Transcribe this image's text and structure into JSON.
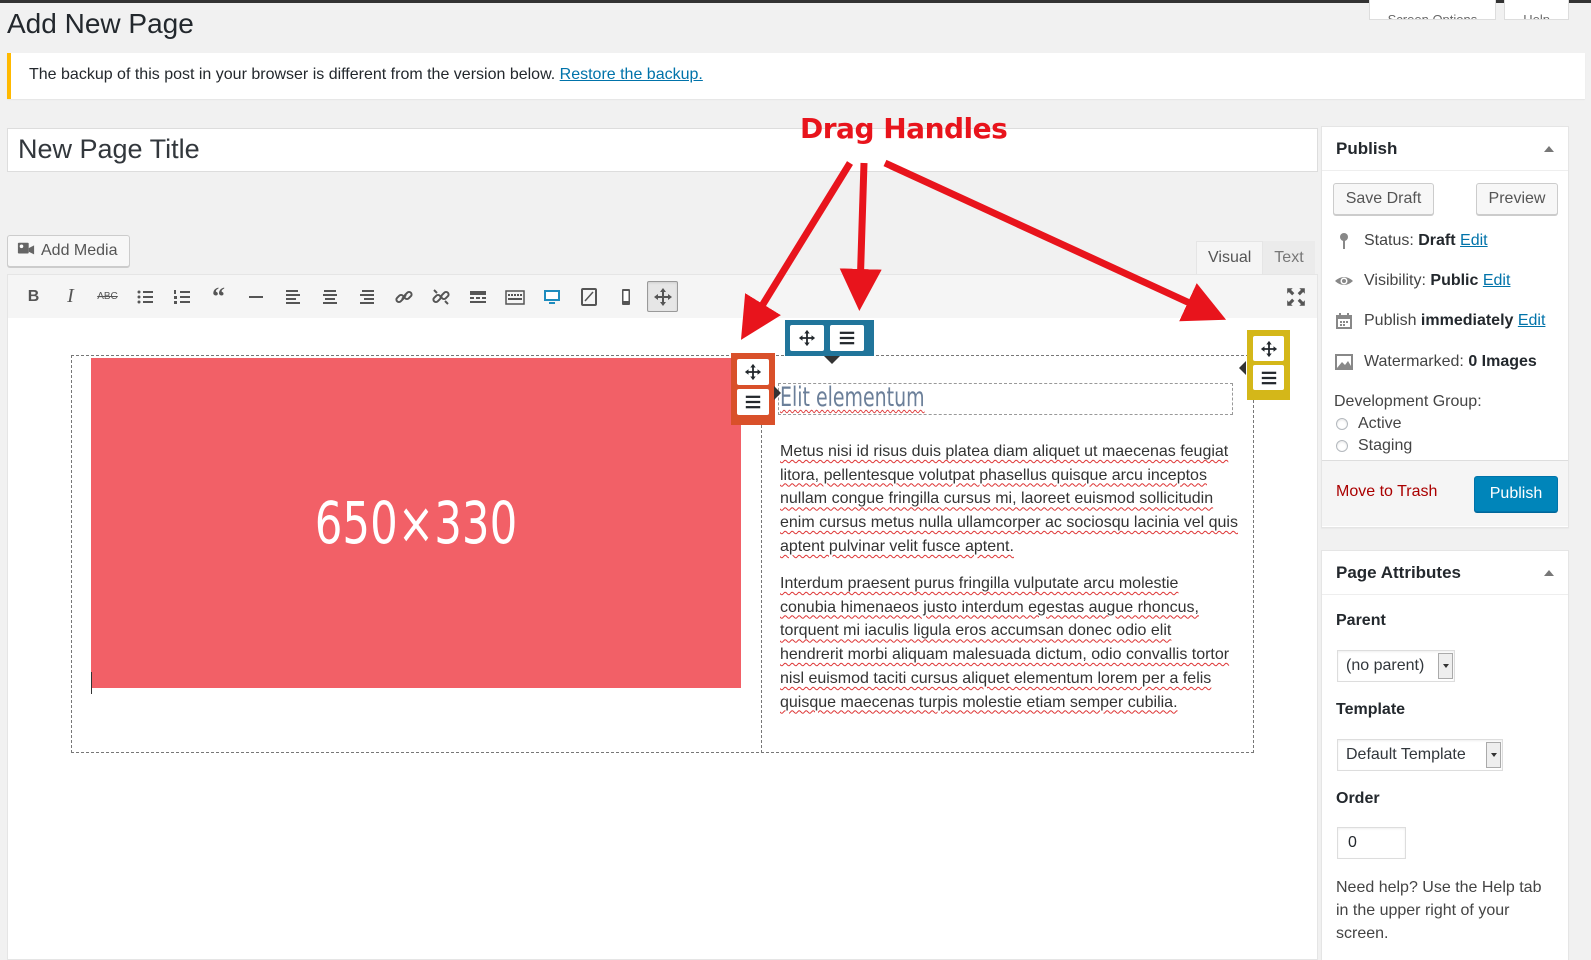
{
  "page": {
    "heading": "Add New Page"
  },
  "screen_tabs": {
    "options": "Screen Options",
    "help": "Help"
  },
  "notice": {
    "text": "The backup of this post in your browser is different from the version below. ",
    "link": "Restore the backup."
  },
  "title_value": "New Page Title",
  "add_media": "Add Media",
  "editor_tabs": {
    "visual": "Visual",
    "text": "Text"
  },
  "toolbar": {
    "bold": "B",
    "italic": "I",
    "strike": "ABC",
    "icons": [
      "bold-icon",
      "italic-icon",
      "strikethrough-icon",
      "bullet-list-icon",
      "numbered-list-icon",
      "blockquote-icon",
      "horizontal-rule-icon",
      "align-left-icon",
      "align-center-icon",
      "align-right-icon",
      "link-icon",
      "unlink-icon",
      "read-more-icon",
      "toolbar-toggle-icon",
      "desktop-icon",
      "tablet-icon",
      "mobile-icon",
      "move-icon",
      "fullscreen-icon"
    ]
  },
  "content": {
    "placeholder": "650×330",
    "heading": "Elit elementum",
    "para1": "Metus nisi id risus duis platea diam aliquet ut maecenas feugiat litora, pellentesque volutpat phasellus quisque arcu inceptos nullam congue fringilla cursus mi, laoreet euismod sollicitudin enim cursus metus nulla ullamcorper ac sociosqu lacinia vel quis aptent pulvinar velit fusce aptent.",
    "para2": "Interdum praesent purus fringilla vulputate arcu molestie conubia himenaeos justo interdum egestas augue rhoncus, torquent mi iaculis ligula eros accumsan donec odio elit hendrerit morbi aliquam malesuada dictum, odio convallis tortor nisl euismod taciti cursus aliquet elementum lorem per a felis quisque maecenas turpis molestie etiam semper cubilia."
  },
  "annotation": {
    "label": "Drag Handles",
    "color": "#e8141c"
  },
  "handle_colors": {
    "red": "#d9502a",
    "blue": "#21759b",
    "yellow": "#d4b719"
  },
  "publish": {
    "title": "Publish",
    "save_draft": "Save Draft",
    "preview": "Preview",
    "status_label": "Status: ",
    "status_value": "Draft",
    "status_edit": "Edit",
    "visibility_label": "Visibility: ",
    "visibility_value": "Public",
    "visibility_edit": "Edit",
    "schedule_label": "Publish ",
    "schedule_value": "immediately",
    "schedule_edit": "Edit",
    "watermark_label": "Watermarked: ",
    "watermark_value": "0 Images",
    "dev_group_label": "Development Group:",
    "dev_group_options": [
      "Active",
      "Staging"
    ],
    "trash": "Move to Trash",
    "publish_button": "Publish"
  },
  "attributes": {
    "title": "Page Attributes",
    "parent_label": "Parent",
    "parent_value": "(no parent)",
    "template_label": "Template",
    "template_value": "Default Template",
    "order_label": "Order",
    "order_value": "0",
    "help": "Need help? Use the Help tab in the upper right of your screen."
  }
}
